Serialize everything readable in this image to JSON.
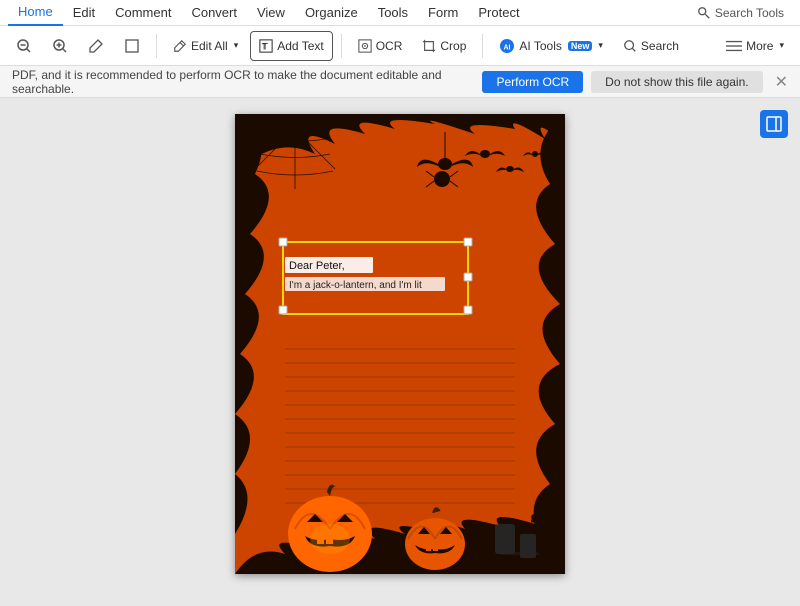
{
  "menubar": {
    "items": [
      {
        "id": "home",
        "label": "Home",
        "active": true
      },
      {
        "id": "edit",
        "label": "Edit",
        "active": false
      },
      {
        "id": "comment",
        "label": "Comment",
        "active": false
      },
      {
        "id": "convert",
        "label": "Convert",
        "active": false
      },
      {
        "id": "view",
        "label": "View",
        "active": false
      },
      {
        "id": "organize",
        "label": "Organize",
        "active": false
      },
      {
        "id": "tools",
        "label": "Tools",
        "active": false
      },
      {
        "id": "form",
        "label": "Form",
        "active": false
      },
      {
        "id": "protect",
        "label": "Protect",
        "active": false
      }
    ],
    "search_label": "Search Tools",
    "search_icon": "search-icon"
  },
  "toolbar": {
    "buttons": [
      {
        "id": "zoom-out",
        "icon": "🔍",
        "label": "",
        "type": "icon-only"
      },
      {
        "id": "zoom-in",
        "icon": "🔍",
        "label": "",
        "type": "icon-only"
      },
      {
        "id": "highlight",
        "icon": "✏",
        "label": "",
        "type": "icon-only"
      },
      {
        "id": "select-rect",
        "icon": "▭",
        "label": "",
        "type": "icon-only"
      },
      {
        "id": "edit-all",
        "icon": "✏",
        "label": "Edit All",
        "has_dropdown": true,
        "active": false
      },
      {
        "id": "add-text",
        "icon": "T",
        "label": "Add Text",
        "active": true
      },
      {
        "id": "ocr",
        "icon": "◉",
        "label": "OCR",
        "active": false
      },
      {
        "id": "crop",
        "icon": "⊡",
        "label": "Crop",
        "active": false
      },
      {
        "id": "ai-tools",
        "icon": "AI",
        "label": "AI Tools",
        "has_badge": true,
        "has_dropdown": true,
        "active": false
      },
      {
        "id": "search",
        "icon": "🔍",
        "label": "Search",
        "active": false
      },
      {
        "id": "more",
        "icon": "≡",
        "label": "More",
        "has_dropdown": true,
        "active": false
      }
    ]
  },
  "notification": {
    "text": "PDF, and it is recommended to perform OCR to make the document editable and searchable.",
    "perform_ocr_label": "Perform OCR",
    "dismiss_label": "Do not show this file again."
  },
  "document": {
    "text_box": {
      "line1": "Dear Peter,",
      "line2": "I'm a jack-o-lantern, and I'm lit"
    },
    "writing_lines_count": 12
  },
  "colors": {
    "accent": "#1a73e8",
    "active_tab": "#1a73e8",
    "toolbar_active_border": "#333333",
    "halloween_bg": "#cc4400",
    "selection_border": "#ffd700",
    "notif_bg": "#f5f5f5"
  }
}
